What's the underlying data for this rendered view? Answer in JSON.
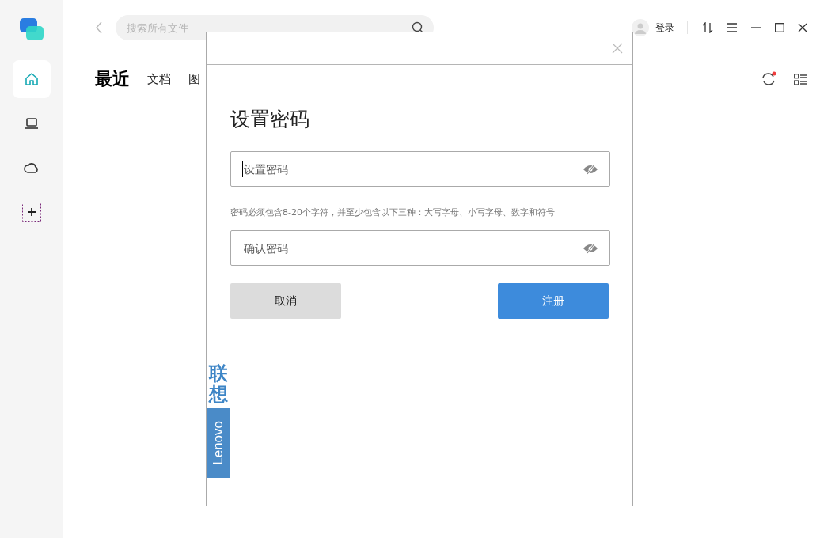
{
  "sidebar": {
    "items": [
      {
        "kind": "nav",
        "selected": true
      },
      {
        "kind": "nav",
        "selected": false
      },
      {
        "kind": "nav",
        "selected": false
      },
      {
        "kind": "add"
      }
    ]
  },
  "search": {
    "placeholder": "搜索所有文件"
  },
  "account": {
    "login": "登录"
  },
  "tabs": [
    {
      "label": "最近",
      "selected": true
    },
    {
      "label": "文档",
      "selected": false
    },
    {
      "label": "图",
      "selected": false
    }
  ],
  "refresh": {
    "badge": true
  },
  "dialog": {
    "title": "设置密码",
    "fields": [
      {
        "placeholder": "设置密码",
        "focused": true,
        "revealed": false,
        "hint": "密码必须包含8-20个字符，并至少包含以下三种：大写字母、小写字母、数字和符号"
      },
      {
        "placeholder": "确认密码",
        "focused": false,
        "revealed": false
      }
    ],
    "buttons": [
      {
        "label": "取消",
        "kind": "secondary"
      },
      {
        "label": "注册",
        "kind": "primary"
      }
    ],
    "brand": {
      "name_cn": "联想",
      "name_en": "Lenovo"
    }
  }
}
